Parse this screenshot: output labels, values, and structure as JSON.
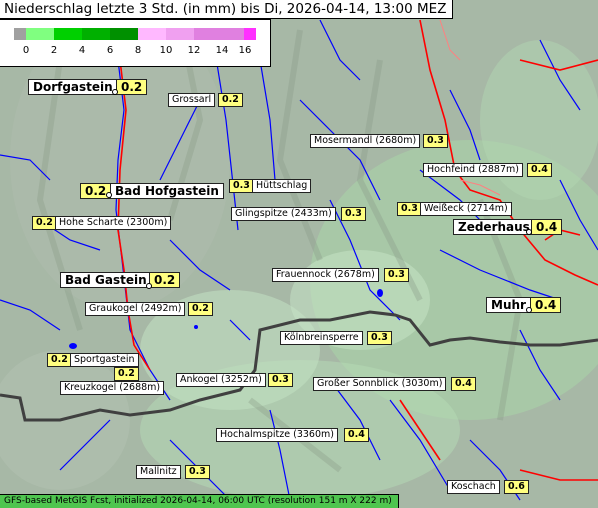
{
  "title": "Niederschlag letzte 3 Std. (in mm) bis Di, 2026-04-14, 13:00 MEZ",
  "footer": "GFS-based MetGIS Fcst, initialized 2026-04-14, 06:00 UTC  (resolution 151 m X 222 m)",
  "legend": {
    "ticks": [
      "0",
      "2",
      "4",
      "6",
      "8",
      "10",
      "12",
      "14",
      "16"
    ],
    "colors": [
      "#a0a0a0",
      "#80ff80",
      "#00d000",
      "#00b000",
      "#009000",
      "#ffb8ff",
      "#f0a0f0",
      "#e080e0",
      "#ff30ff"
    ]
  },
  "colors": {
    "terrain": "#9fb3a0",
    "rivers": "#0000ff",
    "roads": "#ff0000",
    "border": "#404040",
    "value_box": "#ffff80"
  },
  "places": [
    {
      "name": "Dorfgastein",
      "value": "0.2",
      "big": true
    },
    {
      "name": "Grossarl",
      "value": "0.2",
      "big": false
    },
    {
      "name": "Mosermandl (2680m)",
      "value": "0.3",
      "big": false
    },
    {
      "name": "Hochfeind (2887m)",
      "value": "0.4",
      "big": false
    },
    {
      "name": "Bad Hofgastein",
      "value": "0.2",
      "big": true
    },
    {
      "name": "Hüttschlag",
      "value": "0.3",
      "big": false
    },
    {
      "name": "Weißeck (2714m)",
      "value": "0.3",
      "big": false
    },
    {
      "name": "Hohe Scharte (2300m)",
      "value": "0.2",
      "big": false
    },
    {
      "name": "Glingspitze (2433m)",
      "value": "0.3",
      "big": false
    },
    {
      "name": "Zederhaus",
      "value": "0.4",
      "big": true
    },
    {
      "name": "Bad Gastein",
      "value": "0.2",
      "big": true
    },
    {
      "name": "Frauennock (2678m)",
      "value": "0.3",
      "big": false
    },
    {
      "name": "Muhr",
      "value": "0.4",
      "big": true
    },
    {
      "name": "Graukogel (2492m)",
      "value": "0.2",
      "big": false
    },
    {
      "name": "Kölnbreinsperre",
      "value": "0.3",
      "big": false
    },
    {
      "name": "Sportgastein",
      "value": "0.2",
      "big": false
    },
    {
      "name": "Kreuzkogel (2688m)",
      "value": "0.2",
      "big": false
    },
    {
      "name": "Ankogel (3252m)",
      "value": "0.3",
      "big": false
    },
    {
      "name": "Großer Sonnblick (3030m)",
      "value": "0.4",
      "big": false
    },
    {
      "name": "Hochalmspitze (3360m)",
      "value": "0.4",
      "big": false
    },
    {
      "name": "Mallnitz",
      "value": "0.3",
      "big": false
    },
    {
      "name": "Koschach",
      "value": "0.6",
      "big": false
    }
  ]
}
